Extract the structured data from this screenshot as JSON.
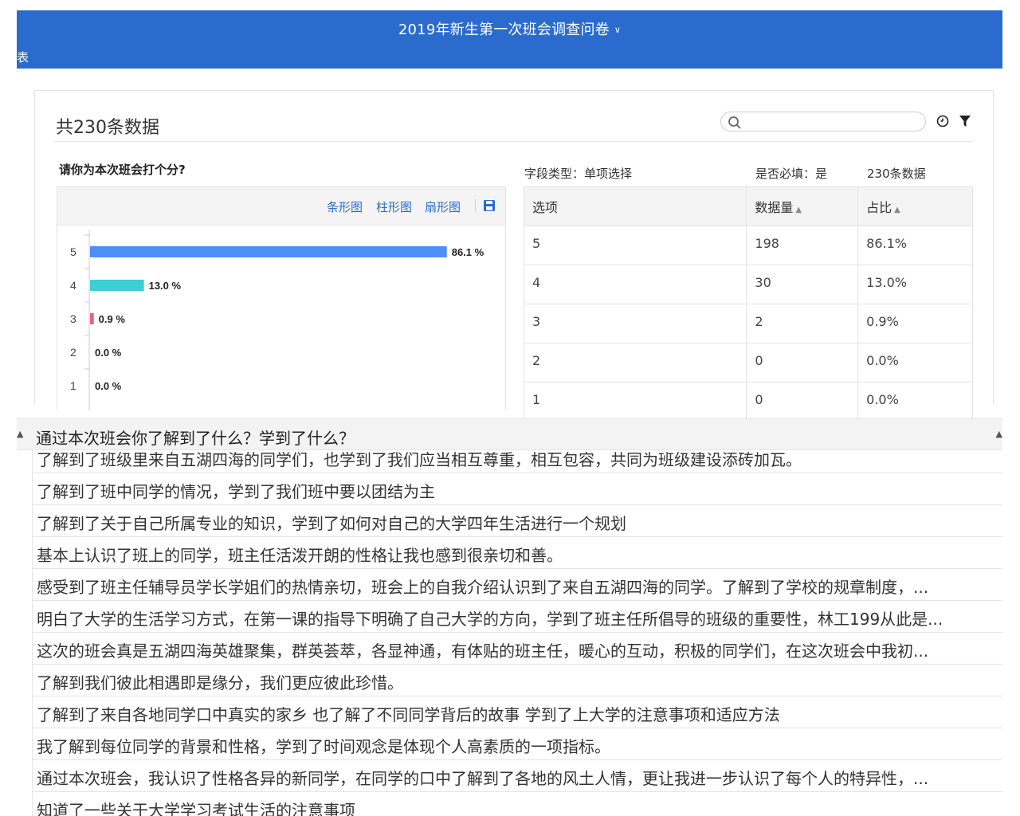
{
  "header": {
    "title": "2019年新生第一次班会调查问卷",
    "left_label": "表"
  },
  "panel": {
    "count_title": "共230条数据",
    "question": "请你为本次班会打个分?",
    "field_type": "字段类型：单项选择",
    "required": "是否必填：是",
    "data_count": "230条数据",
    "chart_toolbar": [
      "条形图",
      "柱形图",
      "扇形图"
    ]
  },
  "chart_data": {
    "type": "bar",
    "orientation": "horizontal",
    "categories": [
      "5",
      "4",
      "3",
      "2",
      "1"
    ],
    "values": [
      86.1,
      13.0,
      0.9,
      0.0,
      0.0
    ],
    "labels": [
      "86.1 %",
      "13.0 %",
      "0.9 %",
      "0.0 %",
      "0.0 %"
    ],
    "colors": [
      "#4f8ef7",
      "#3ccfd4",
      "#e8607a",
      "#999999",
      "#999999"
    ],
    "xlim": [
      0,
      100
    ]
  },
  "table": {
    "headers": [
      "选项",
      "数据量",
      "占比"
    ],
    "rows": [
      [
        "5",
        "198",
        "86.1%"
      ],
      [
        "4",
        "30",
        "13.0%"
      ],
      [
        "3",
        "2",
        "0.9%"
      ],
      [
        "2",
        "0",
        "0.0%"
      ],
      [
        "1",
        "0",
        "0.0%"
      ]
    ]
  },
  "answers": {
    "title": "通过本次班会你了解到了什么？学到了什么？",
    "items": [
      "了解到了班级里来自五湖四海的同学们，也学到了我们应当相互尊重，相互包容，共同为班级建设添砖加瓦。",
      "了解到了班中同学的情况，学到了我们班中要以团结为主",
      "了解到了关于自己所属专业的知识，学到了如何对自己的大学四年生活进行一个规划",
      "基本上认识了班上的同学，班主任活泼开朗的性格让我也感到很亲切和善。",
      "感受到了班主任辅导员学长学姐们的热情亲切，班会上的自我介绍认识到了来自五湖四海的同学。了解到了学校的规章制度，...",
      "明白了大学的生活学习方式，在第一课的指导下明确了自己大学的方向，学到了班主任所倡导的班级的重要性，林工199从此是...",
      "这次的班会真是五湖四海英雄聚集，群英荟萃，各显神通，有体贴的班主任，暖心的互动，积极的同学们，在这次班会中我初...",
      "了解到我们彼此相遇即是缘分，我们更应彼此珍惜。",
      "了解到了来自各地同学口中真实的家乡 也了解了不同同学背后的故事 学到了上大学的注意事项和适应方法",
      "我了解到每位同学的背景和性格，学到了时间观念是体现个人高素质的一项指标。",
      "通过本次班会，我认识了性格各异的新同学，在同学的口中了解到了各地的风土人情，更让我进一步认识了每个人的特异性，...",
      "知道了一些关于大学学习考试生活的注意事项"
    ]
  }
}
